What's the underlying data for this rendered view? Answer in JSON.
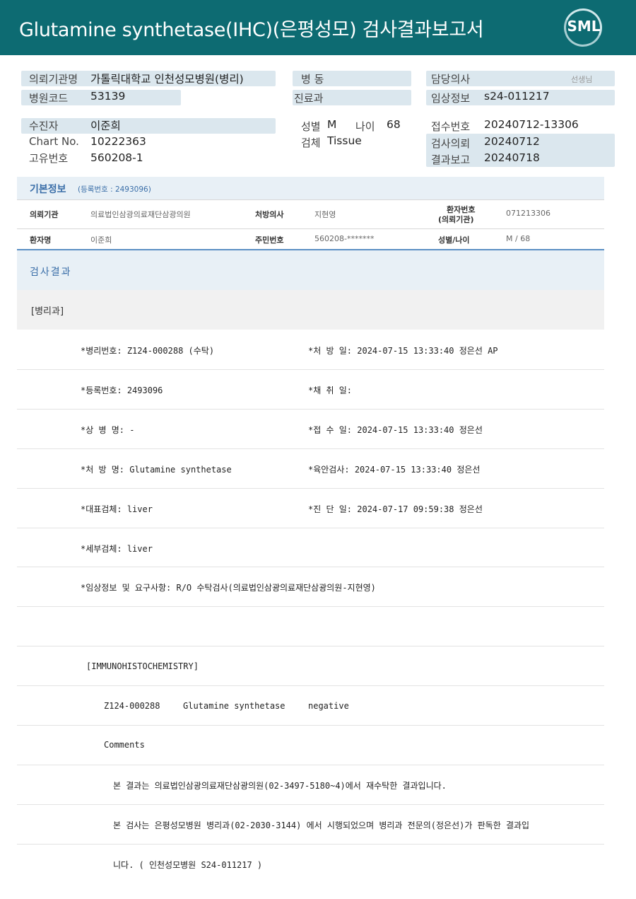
{
  "header": {
    "title": "Glutamine  synthetase(IHC)(은평성모) 검사결과보고서",
    "logo_text": "SML"
  },
  "patient_block": {
    "requesting_org_label": "의뢰기관명",
    "requesting_org_value": "가톨릭대학교 인천성모병원(병리)",
    "ward_label": "병  동",
    "doctor_label": "담당의사",
    "doctor_suffix": "선생님",
    "hospital_code_label": "병원코드",
    "hospital_code_value": "53139",
    "department_label": "진료과",
    "clinical_info_label": "임상정보",
    "clinical_info_value": "s24-011217",
    "examinee_label": "수진자",
    "examinee_value": "이준희",
    "sex_label": "성별",
    "sex_value": "M",
    "age_label": "나이",
    "age_value": "68",
    "receipt_label": "접수번호",
    "receipt_value": "20240712-13306",
    "chart_label": "Chart No.",
    "chart_value": "10222363",
    "specimen_label": "검체",
    "specimen_value": "Tissue",
    "test_request_label": "검사의뢰",
    "test_request_value": "20240712",
    "unique_label": "고유번호",
    "unique_value": "560208-1",
    "result_report_label": "결과보고",
    "result_report_value": "20240718"
  },
  "basic_info": {
    "title": "기본정보",
    "subtitle": "(등록번호 : 2493096)",
    "org_label": "의뢰기관",
    "org_value": "의료법인삼광의료재단삼광의원",
    "prescriber_label": "처방의사",
    "prescriber_value": "지현영",
    "patient_no_label_1": "환자번호",
    "patient_no_label_2": "(의뢰기관)",
    "patient_no_value": "071213306",
    "patient_name_label": "환자명",
    "patient_name_value": "이준희",
    "rrn_label": "주민번호",
    "rrn_value": "560208-*******",
    "sex_age_label": "성별/나이",
    "sex_age_value": "M / 68"
  },
  "results": {
    "section_title": "검사결과",
    "department": "[병리과]",
    "left_lines": [
      "*병리번호: Z124-000288 (수탁)",
      "*등록번호: 2493096",
      "*상 병 명: -",
      "*처 방 명: Glutamine synthetase",
      "*대표검체: liver",
      "*세부검체: liver",
      "*임상정보 및 요구사항: R/O 수탁검사(의료법인삼광의료재단삼광의원-지현영)"
    ],
    "right_lines": [
      "*처 방 일: 2024-07-15 13:33:40  정은선 AP",
      "*채 취 일:",
      "*접 수 일: 2024-07-15 13:33:40  정은선",
      "*육안검사: 2024-07-15 13:33:40  정은선",
      "*진 단 일: 2024-07-17 09:59:38  정은선"
    ],
    "ihc_header": "[IMMUNOHISTOCHEMISTRY]",
    "ihc_case": "Z124-000288",
    "ihc_marker": "Glutamine synthetase",
    "ihc_result": "negative",
    "comments_label": "Comments",
    "comment_1": "본 결과는 의료법인삼광의료재단삼광의원(02-3497-5180~4)에서 재수탁한 결과입니다.",
    "comment_2": "본 검사는 은평성모병원 병리과(02-2030-3144) 에서 시행되었으며 병리과 전문의(정은선)가 판독한 결과입",
    "comment_3": "니다. ( 인천성모병원 S24-011217 )"
  },
  "colors": {
    "header_bg": "#0d6b72",
    "label_pill": "#dbe7ee",
    "section_blue": "#e8f0f6",
    "accent_blue": "#3a6ea8"
  }
}
